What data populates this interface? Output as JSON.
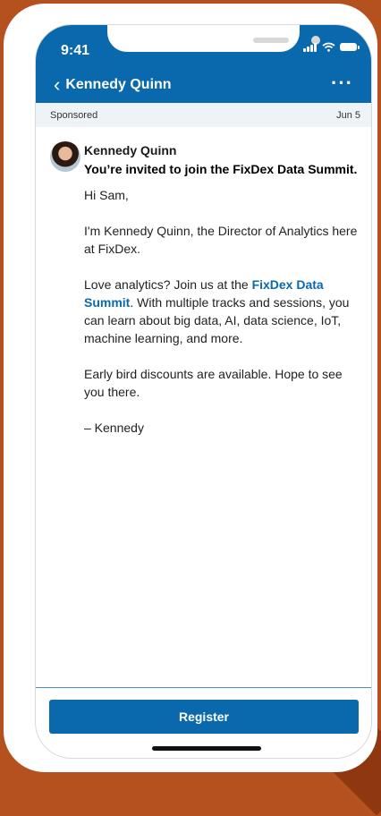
{
  "status": {
    "time": "9:41"
  },
  "header": {
    "title": "Kennedy Quinn",
    "back_icon": "chevron-left-icon",
    "more_icon": "ellipsis-icon"
  },
  "meta": {
    "sponsored": "Sponsored",
    "date": "Jun 5"
  },
  "message": {
    "sender": "Kennedy Quinn",
    "subject": "You’re invited to join the FixDex Data Summit.",
    "greeting": "Hi Sam,",
    "p1": "I'm Kennedy Quinn, the Director of Analytics here at FixDex.",
    "p2_pre": "Love analytics? Join us at the ",
    "p2_link": "FixDex Data Summit",
    "p2_post": ". With multiple tracks and sessions, you can learn about big data, AI, data science, IoT, machine learning, and more.",
    "p3": "Early bird discounts are available. Hope to see you there.",
    "signoff": "– Kennedy"
  },
  "actions": {
    "register": "Register"
  },
  "colors": {
    "brand": "#0a69ad",
    "background": "#b5511f"
  }
}
